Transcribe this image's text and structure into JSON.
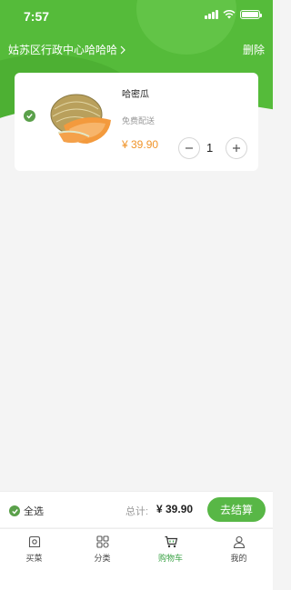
{
  "status_bar": {
    "time": "7:57"
  },
  "header": {
    "location": "姑苏区行政中心哈哈哈",
    "delete_label": "删除"
  },
  "cart": {
    "items": [
      {
        "name": "哈密瓜",
        "delivery": "免费配送",
        "price": "¥ 39.90",
        "quantity": "1",
        "selected": true
      }
    ]
  },
  "checkout": {
    "select_all_label": "全选",
    "total_label": "总计:",
    "total_value": "¥ 39.90",
    "button_label": "去结算"
  },
  "tabbar": {
    "tabs": [
      {
        "label": "买菜",
        "icon": "shop-icon",
        "active": false
      },
      {
        "label": "分类",
        "icon": "category-icon",
        "active": false
      },
      {
        "label": "购物车",
        "icon": "cart-icon",
        "active": true
      },
      {
        "label": "我的",
        "icon": "user-icon",
        "active": false
      }
    ]
  },
  "colors": {
    "brand_green": "#55bb3a",
    "price_orange": "#f0942a",
    "active_tab": "#3aa245"
  }
}
